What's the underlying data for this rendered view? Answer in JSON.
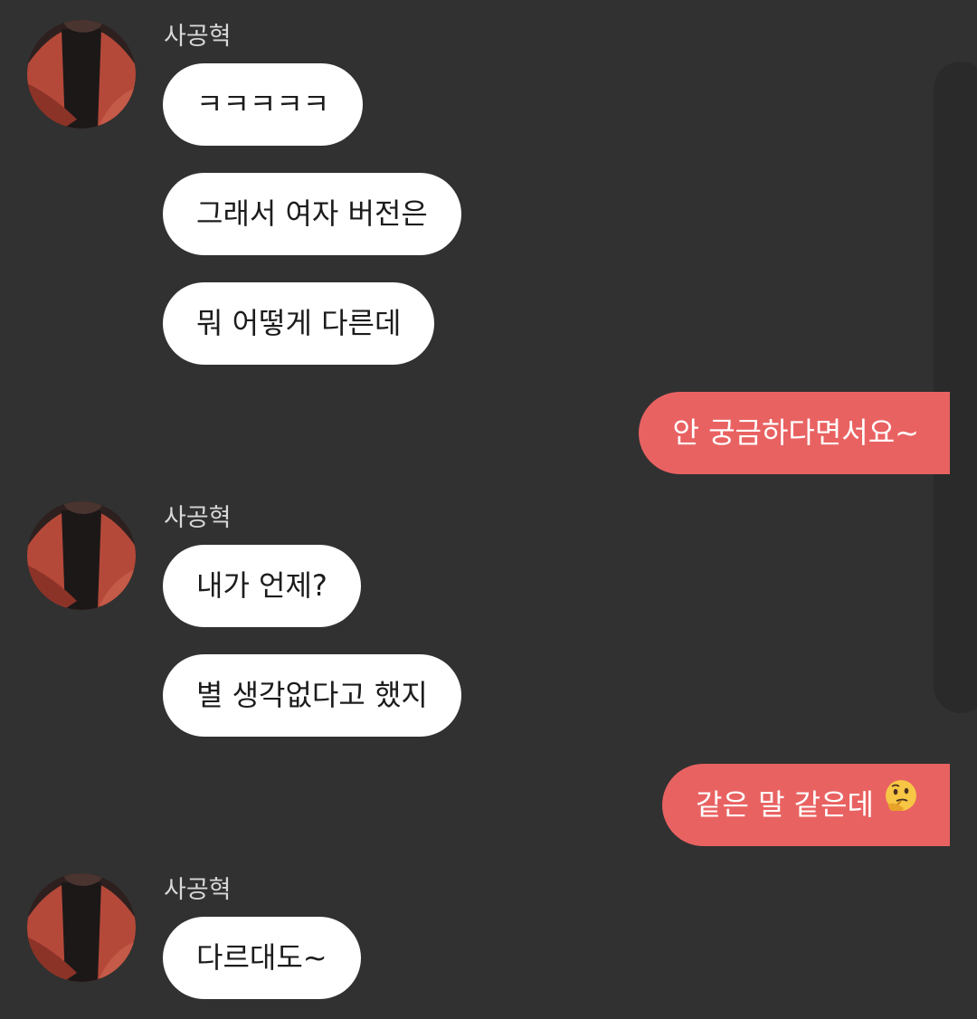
{
  "chat": {
    "contact_name": "사공혁",
    "messages": [
      {
        "from": "other",
        "text": "ㅋㅋㅋㅋㅋ"
      },
      {
        "from": "other",
        "text": "그래서 여자 버전은"
      },
      {
        "from": "other",
        "text": "뭐 어떻게 다른데"
      },
      {
        "from": "me",
        "text": "안 궁금하다면서요~"
      },
      {
        "from": "other",
        "text": "내가 언제?"
      },
      {
        "from": "other",
        "text": "별 생각없다고 했지"
      },
      {
        "from": "me",
        "text": "같은 말 같은데",
        "emoji": "thinking-face-icon"
      },
      {
        "from": "other",
        "text": "다르대도~"
      }
    ]
  },
  "colors": {
    "background": "#313131",
    "incoming_bubble": "#ffffff",
    "outgoing_bubble": "#e96262",
    "sender_name": "#d8d8d8"
  }
}
